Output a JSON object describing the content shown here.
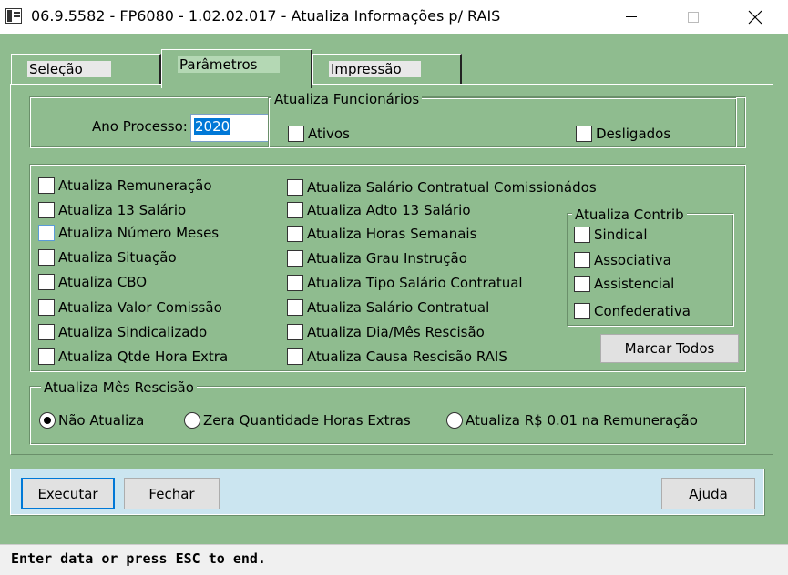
{
  "window": {
    "title": "06.9.5582 - FP6080 - 1.02.02.017 - Atualiza Informações p/ RAIS"
  },
  "tabs": [
    {
      "label": "Seleção"
    },
    {
      "label": "Parâmetros"
    },
    {
      "label": "Impressão"
    }
  ],
  "top_group": {
    "ano_label": "Ano Processo:",
    "ano_value": "2020",
    "func_legend": "Atualiza Funcionários",
    "ativos": "Ativos",
    "desligados": "Desligados"
  },
  "col1": [
    "Atualiza Remuneração",
    "Atualiza 13 Salário",
    "Atualiza Número Meses",
    "Atualiza Situação",
    "Atualiza CBO",
    "Atualiza Valor Comissão",
    "Atualiza Sindicalizado",
    "Atualiza Qtde Hora Extra"
  ],
  "col2": [
    "Atualiza Salário Contratual Comissionádos",
    "Atualiza Adto 13 Salário",
    "Atualiza Horas Semanais",
    "Atualiza Grau Instrução",
    "Atualiza Tipo Salário Contratual",
    "Atualiza Salário Contratual",
    "Atualiza Dia/Mês Rescisão",
    "Atualiza Causa Rescisão RAIS"
  ],
  "contrib": {
    "legend": "Atualiza Contrib",
    "items": [
      "Sindical",
      "Associativa",
      "Assistencial",
      "Confederativa"
    ],
    "marcar_todos": "Marcar Todos"
  },
  "rescisao": {
    "legend": "Atualiza Mês Rescisão",
    "options": [
      "Não Atualiza",
      "Zera Quantidade Horas Extras",
      "Atualiza R$ 0.01  na Remuneração"
    ],
    "selected": "Não Atualiza"
  },
  "buttons": {
    "executar": "Executar",
    "fechar": "Fechar",
    "ajuda": "Ajuda"
  },
  "status": "Enter data or press ESC to end."
}
